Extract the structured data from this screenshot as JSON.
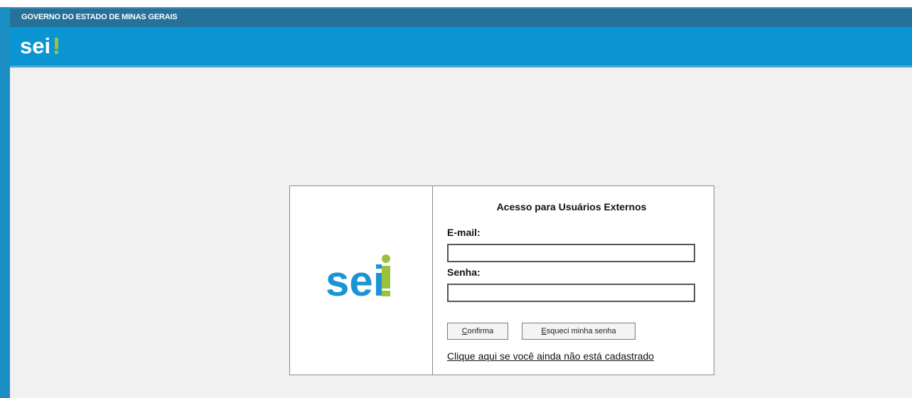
{
  "header": {
    "gov_title": "GOVERNO DO ESTADO DE MINAS GERAIS",
    "brand_logo_text": "sei",
    "brand_logo_mark": "!"
  },
  "login": {
    "logo_text": "sei",
    "logo_mark": "!",
    "title": "Acesso para Usuários Externos",
    "email_label": "E-mail:",
    "email_value": "",
    "senha_label": "Senha:",
    "senha_value": "",
    "confirm_first": "C",
    "confirm_rest": "onfirma",
    "forgot_first": "E",
    "forgot_rest": "squeci minha senha",
    "register_link": "Clique aqui se você ainda não está cadastrado"
  },
  "colors": {
    "brand_blue": "#0a95d2",
    "gov_bar": "#24719a",
    "logo_blue": "#1a94d3",
    "logo_green": "#9bc13c",
    "background": "#f1f1f1"
  }
}
